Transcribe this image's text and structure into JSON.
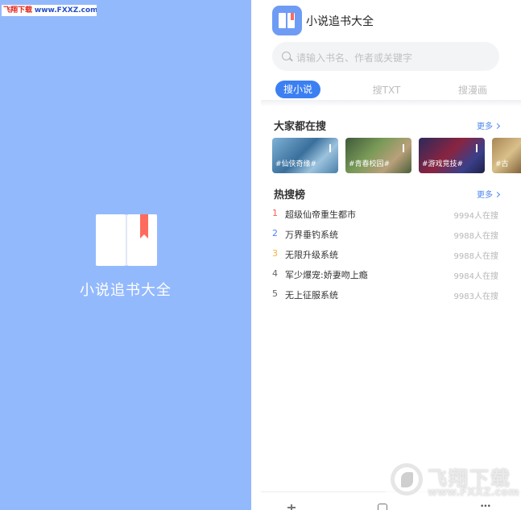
{
  "watermark_top": {
    "brand": "飞翔下载",
    "url": "www.FXXZ.com"
  },
  "splash": {
    "title": "小说追书大全",
    "background": "#93b9fd"
  },
  "app": {
    "title": "小说追书大全",
    "accent": "#3b7ff2",
    "search": {
      "placeholder": "请输入书名、作者或关键字"
    },
    "tabs": [
      {
        "label": "搜小说",
        "active": true
      },
      {
        "label": "搜TXT",
        "active": false
      },
      {
        "label": "搜漫画",
        "active": false
      }
    ],
    "popular": {
      "title": "大家都在搜",
      "more": "更多",
      "cards": [
        {
          "label": "#仙侠奇缘#"
        },
        {
          "label": "#青春校园#"
        },
        {
          "label": "#游戏竞技#"
        },
        {
          "label": "#古"
        }
      ]
    },
    "hot": {
      "title": "热搜榜",
      "more": "更多",
      "items": [
        {
          "rank": "1",
          "name": "超级仙帝重生都市",
          "count": "9994人在搜",
          "rank_color": "#ff5a4f"
        },
        {
          "rank": "2",
          "name": "万界垂钓系统",
          "count": "9988人在搜",
          "rank_color": "#4a86f0"
        },
        {
          "rank": "3",
          "name": "无限升级系统",
          "count": "9988人在搜",
          "rank_color": "#f5b23c"
        },
        {
          "rank": "4",
          "name": "军少爆宠:娇妻吻上瘾",
          "count": "9984人在搜",
          "rank_color": "#666666"
        },
        {
          "rank": "5",
          "name": "无上征服系统",
          "count": "9983人在搜",
          "rank_color": "#666666"
        }
      ]
    }
  },
  "watermark_br": {
    "brand": "飞翔下载",
    "url": "www.FXXZ.com"
  }
}
